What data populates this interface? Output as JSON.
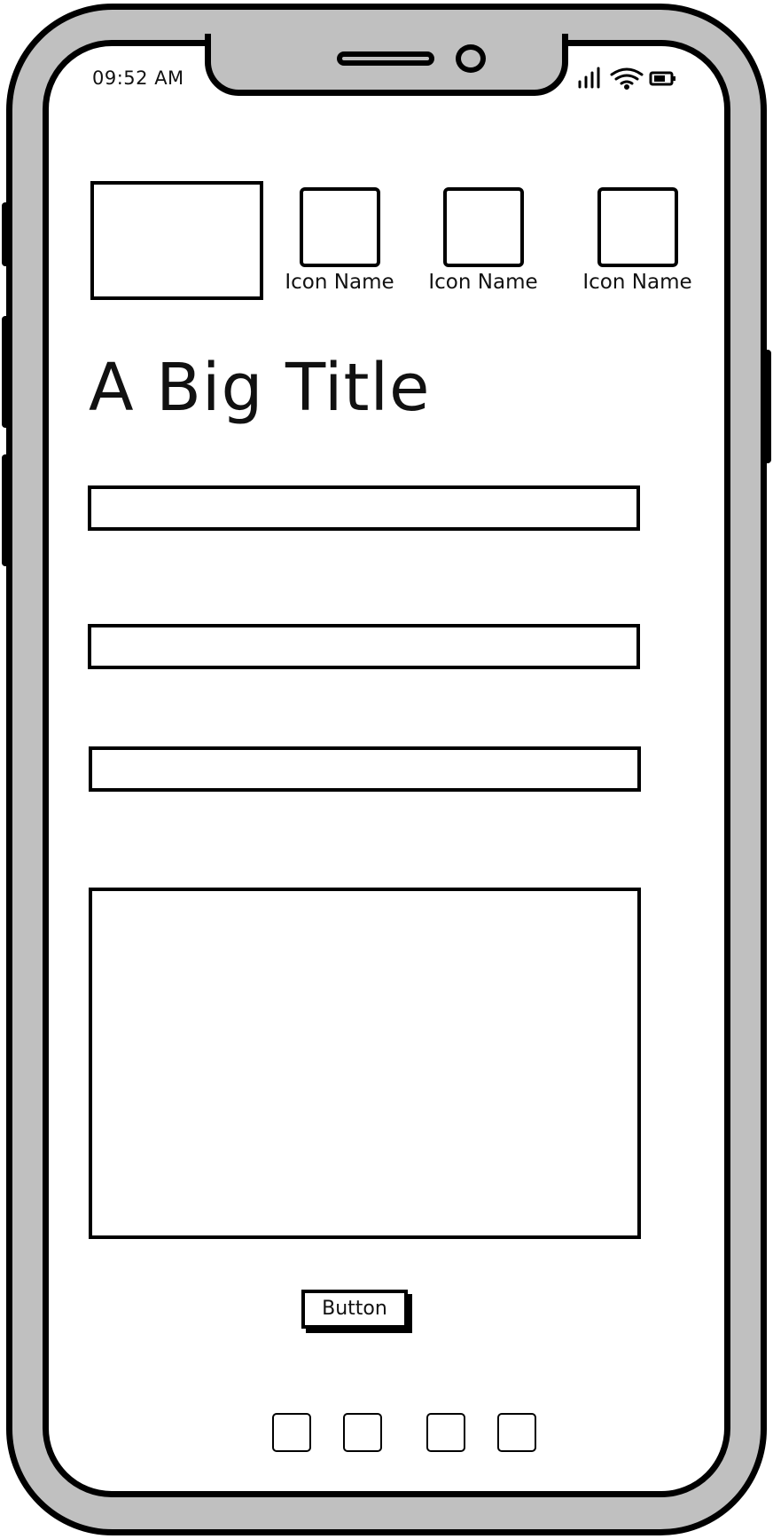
{
  "status_bar": {
    "time": "09:52 AM",
    "icons": [
      "signal-icon",
      "wifi-icon",
      "battery-icon"
    ]
  },
  "header": {
    "image_placeholder": "image-placeholder",
    "icons": [
      {
        "name": "Icon Name"
      },
      {
        "name": "Icon Name"
      },
      {
        "name": "Icon Name"
      }
    ]
  },
  "main": {
    "title": "A Big Title",
    "fields": [
      "",
      "",
      ""
    ],
    "content_box": ""
  },
  "action": {
    "button_label": "Button"
  },
  "dock": {
    "items": [
      "dock-item",
      "dock-item",
      "dock-item",
      "dock-item"
    ]
  },
  "colors": {
    "frame": "#c0c0c0",
    "stroke": "#000000",
    "screen": "#ffffff"
  }
}
